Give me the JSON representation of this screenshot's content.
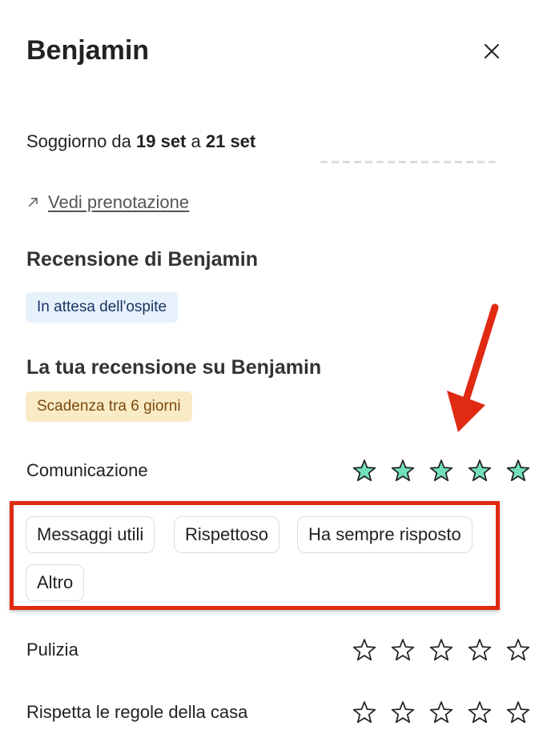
{
  "header": {
    "guest_name": "Benjamin"
  },
  "stay": {
    "prefix": "Soggiorno da ",
    "from": "19 set",
    "middle": " a ",
    "to": "21 set"
  },
  "booking_link": {
    "label": "Vedi prenotazione"
  },
  "guest_review": {
    "title": "Recensione di Benjamin",
    "status": "In attesa dell'ospite"
  },
  "your_review": {
    "title": "La tua recensione su Benjamin",
    "deadline": "Scadenza tra 6 giorni"
  },
  "ratings": [
    {
      "label": "Comunicazione",
      "stars_filled": 5,
      "stars_total": 5,
      "tags": [
        "Messaggi utili",
        "Rispettoso",
        "Ha sempre risposto",
        "Altro"
      ]
    },
    {
      "label": "Pulizia",
      "stars_filled": 0,
      "stars_total": 5
    },
    {
      "label": "Rispetta le regole della casa",
      "stars_filled": 0,
      "stars_total": 5
    }
  ],
  "colors": {
    "star_filled": "#72e0b8",
    "star_stroke": "#1f1f1f",
    "annotation_red": "#e02a12",
    "badge_blue_bg": "#e7f1fb",
    "badge_yellow_bg": "#f9ebc6"
  },
  "icons": {
    "close": "close-icon",
    "external_link": "arrow-up-right-icon",
    "star": "star-icon"
  }
}
